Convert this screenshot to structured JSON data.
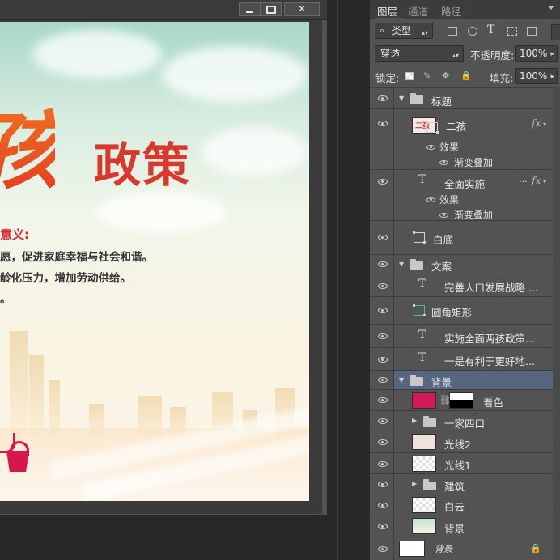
{
  "window": {
    "buttons": {
      "minimize": "minimize",
      "maximize": "maximize",
      "close": "✕"
    }
  },
  "artwork": {
    "title_main": "孩",
    "title_sub": "政策",
    "meaning_heading": "意义:",
    "meaning_lines": [
      "愿，促进家庭幸福与社会和谐。",
      "龄化压力，增加劳动供给。",
      "。"
    ],
    "colors": {
      "title": "#e44f1e",
      "subtitle": "#d9392d",
      "heading": "#d6282f",
      "bucket": "#d8164e"
    }
  },
  "panel": {
    "tabs": [
      "图层",
      "通道",
      "路径"
    ],
    "active_tab": "图层",
    "filter": {
      "label": "类型",
      "icon": "search-icon"
    },
    "blend_mode": "穿透",
    "opacity_label": "不透明度:",
    "opacity_value": "100%",
    "lock_label": "锁定:",
    "fill_label": "填充:",
    "fill_value": "100%",
    "layers": [
      {
        "name": "标题",
        "kind": "group",
        "expanded": true,
        "indent": 0
      },
      {
        "name": "二孩",
        "kind": "smart",
        "indent": 1,
        "fx": "fx",
        "effects_label": "效果",
        "effects": [
          "渐变叠加"
        ]
      },
      {
        "name": "全面实施",
        "kind": "text",
        "indent": 1,
        "fx": "fx",
        "effects_label": "效果",
        "effects": [
          "渐变叠加"
        ],
        "suffix": "..."
      },
      {
        "name": "白底",
        "kind": "shape",
        "indent": 1
      },
      {
        "name": "文案",
        "kind": "group",
        "expanded": true,
        "indent": 0
      },
      {
        "name": "完善人口发展战略 ...",
        "kind": "text",
        "indent": 1
      },
      {
        "name": "圆角矩形",
        "kind": "shape",
        "indent": 1
      },
      {
        "name": "实施全面两孩政策...",
        "kind": "text",
        "indent": 1
      },
      {
        "name": "一是有利于更好地...",
        "kind": "text",
        "indent": 1
      },
      {
        "name": "背景",
        "kind": "group",
        "expanded": true,
        "indent": 0,
        "selected": true
      },
      {
        "name": "着色",
        "kind": "adjustment",
        "indent": 1,
        "fill_color": "#d11a5a"
      },
      {
        "name": "一家四口",
        "kind": "group",
        "expanded": false,
        "indent": 1
      },
      {
        "name": "光线2",
        "kind": "raster",
        "indent": 1
      },
      {
        "name": "光线1",
        "kind": "raster",
        "indent": 1
      },
      {
        "name": "建筑",
        "kind": "group",
        "expanded": false,
        "indent": 1
      },
      {
        "name": "白云",
        "kind": "raster",
        "indent": 1
      },
      {
        "name": "背景",
        "kind": "raster",
        "indent": 1
      },
      {
        "name": "背景",
        "kind": "background",
        "indent": 0,
        "locked": true
      }
    ]
  }
}
